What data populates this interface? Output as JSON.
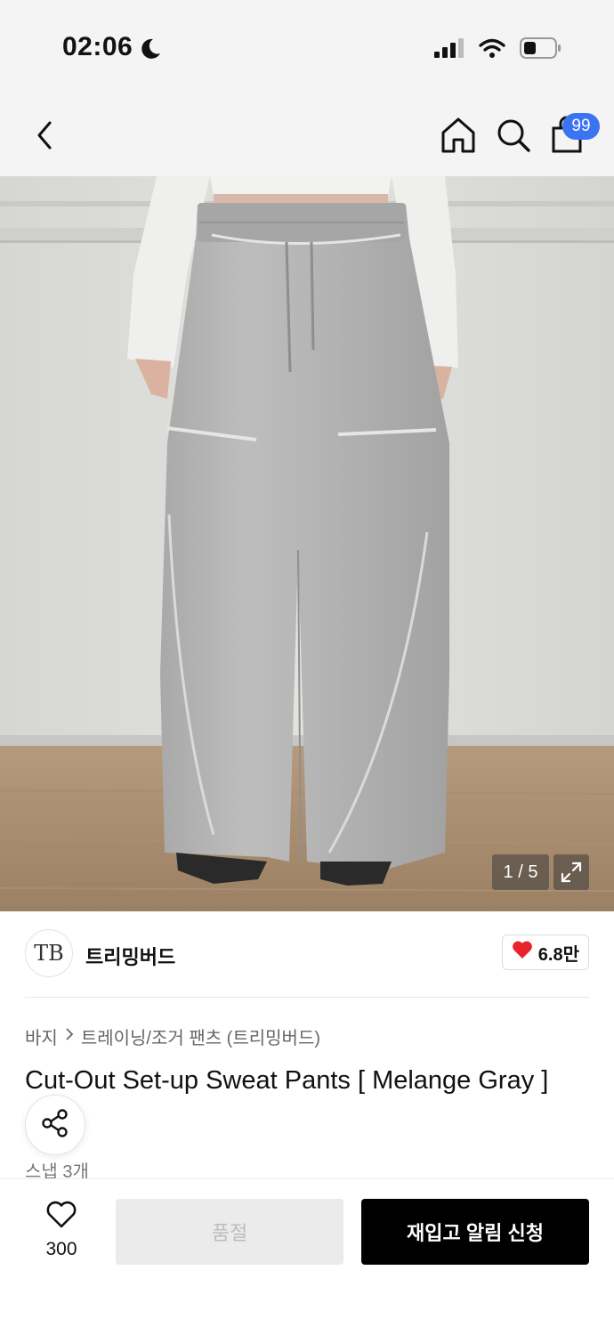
{
  "status_bar": {
    "time": "02:06",
    "icons": [
      "moon-icon",
      "signal-icon",
      "wifi-icon",
      "battery-icon"
    ]
  },
  "nav": {
    "icons": [
      "back-icon",
      "home-icon",
      "search-icon",
      "shopping-bag-icon"
    ],
    "cart_badge": "99"
  },
  "gallery": {
    "counter": "1 / 5",
    "expand_icon": "expand-icon"
  },
  "brand": {
    "logo_text": "TB",
    "name": "트리밍버드",
    "likes": "6.8만"
  },
  "breadcrumb": {
    "category": "바지",
    "subcategory": "트레이닝/조거 팬츠 (트리밍버드)"
  },
  "product": {
    "title": "Cut-Out Set-up Sweat Pants [ Melange Gray ]",
    "snap": "스냅 3개"
  },
  "bottom_bar": {
    "wish_count": "300",
    "soldout_label": "품절",
    "restock_label": "재입고 알림 신청"
  },
  "colors": {
    "accent_badge": "#3b74f2",
    "like_heart": "#e8232c",
    "primary_button": "#000000",
    "disabled_button": "#ebebeb"
  }
}
